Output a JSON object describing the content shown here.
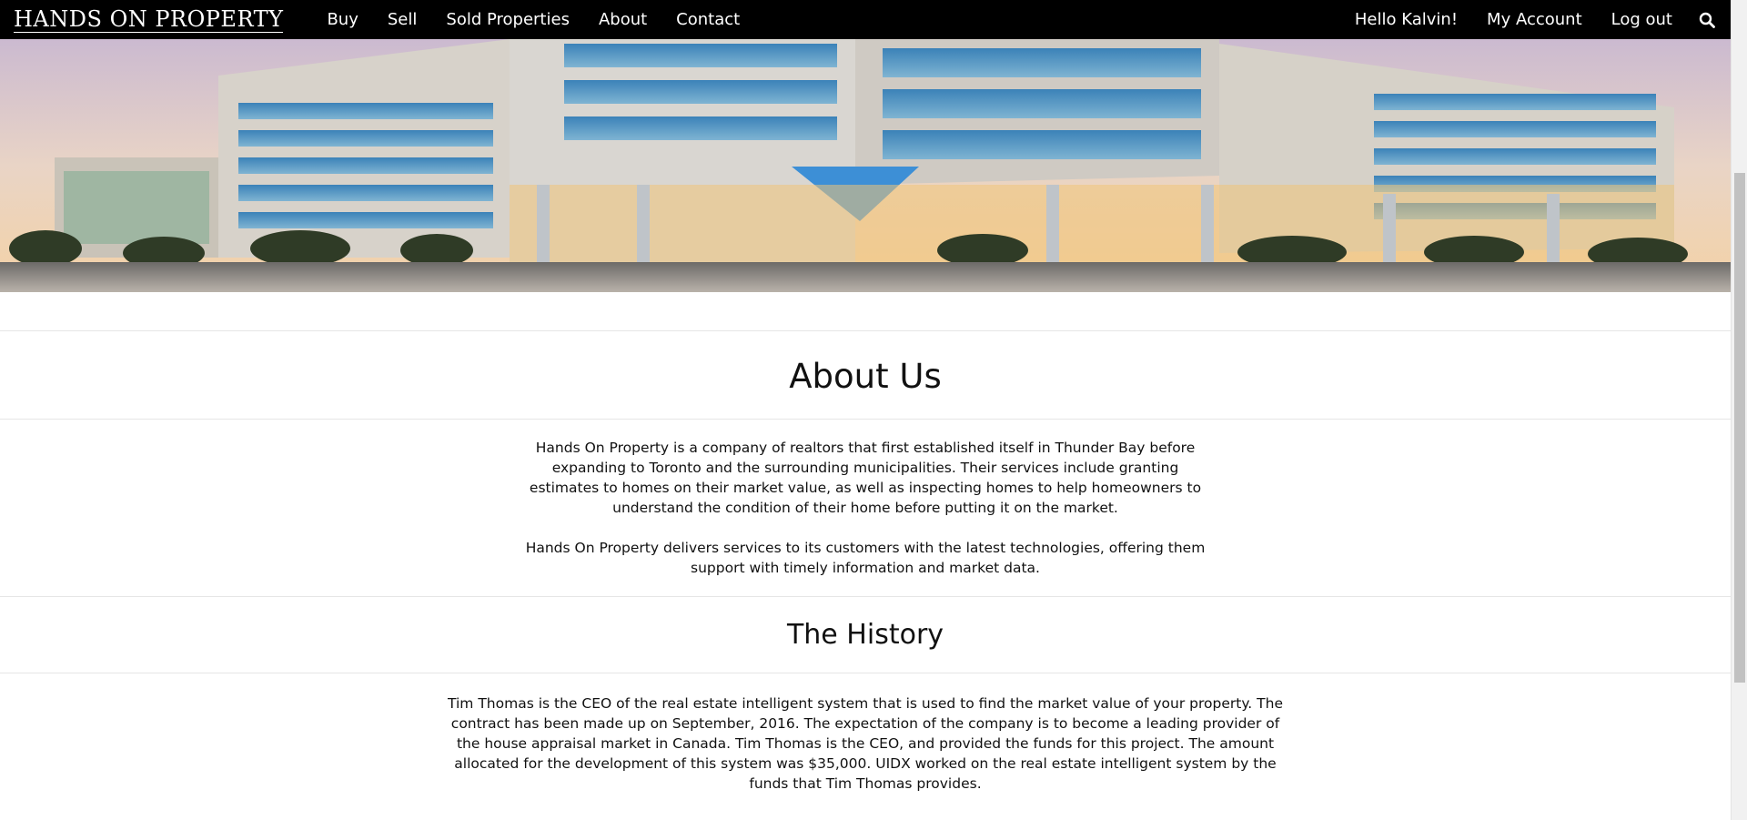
{
  "nav": {
    "brand": "HANDS ON PROPERTY",
    "left_links": [
      "Buy",
      "Sell",
      "Sold Properties",
      "About",
      "Contact"
    ],
    "greeting": "Hello Kalvin!",
    "account": "My Account",
    "logout": "Log out",
    "search_icon": "search-icon"
  },
  "about": {
    "title": "About Us",
    "p1": "Hands On Property is a company of realtors that first established itself in Thunder Bay before expanding to Toronto and the surrounding municipalities. Their services include granting estimates to homes on their market value, as well as inspecting homes to help homeowners to understand the condition of their home before putting it on the market.",
    "p2": "Hands On Property delivers services to its customers with the latest technologies, offering them support with timely information and market data."
  },
  "history": {
    "title": "The History",
    "p1": "Tim Thomas is the CEO of the real estate intelligent system that is used to find the market value of your property. The contract has been made up on September, 2016. The expectation of the company is to become a leading provider of the house appraisal market in Canada. Tim Thomas is the CEO, and provided the funds for this project. The amount allocated for the development of this system was $35,000. UIDX worked on the real estate intelligent system by the funds that Tim Thomas provides."
  }
}
